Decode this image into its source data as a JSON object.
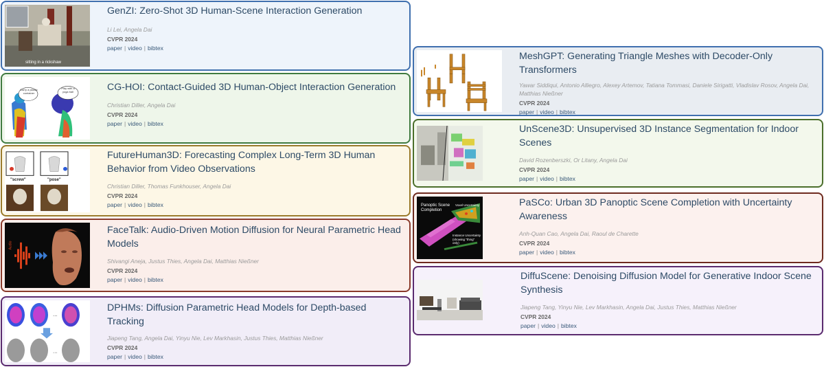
{
  "papers": [
    {
      "title": "GenZI: Zero-Shot 3D Human-Scene Interaction Generation",
      "authors": "Li Lei, Angela Dai",
      "venue": "CVPR 2024",
      "thumb_caption": "sitting in a rickshaw",
      "border": "#3f6fae",
      "bg": "#eef4fb"
    },
    {
      "title": "CG-HOI: Contact-Guided 3D Human-Object Interaction Generation",
      "authors": "Christian Diller, Angela Dai",
      "venue": "CVPR 2024",
      "thumb_labels": [
        "Carry a plastic container",
        "Play with a yoga ball"
      ],
      "border": "#3f7a3f",
      "bg": "#eef6ea"
    },
    {
      "title": "FutureHuman3D: Forecasting Complex Long-Term 3D Human Behavior from Video Observations",
      "authors": "Christian Diller, Thomas Funkhouser, Angela Dai",
      "venue": "CVPR 2024",
      "thumb_labels": [
        "\"screw\"",
        "\"pose\""
      ],
      "border": "#9a7a2a",
      "bg": "#fdf7e6"
    },
    {
      "title": "FaceTalk: Audio-Driven Motion Diffusion for Neural Parametric Head Models",
      "authors": "Shivangi Aneja, Justus Thies, Angela Dai, Matthias Nießner",
      "venue": "CVPR 2024",
      "thumb_label": "Audio",
      "border": "#8a3a2a",
      "bg": "#fbeeea"
    },
    {
      "title": "DPHMs: Diffusion Parametric Head Models for Depth-based Tracking",
      "authors": "Jiapeng Tang, Angela Dai, Yinyu Nie, Lev Markhasin, Justus Thies, Matthias Nießner",
      "venue": "CVPR 2024",
      "border": "#5a2a6e",
      "bg": "#f1edf8"
    },
    {
      "title": "MeshGPT: Generating Triangle Meshes with Decoder-Only Transformers",
      "authors": "Yawar Siddiqui, Antonio Alliegro, Alexey Artemov, Tatiana Tommasi, Daniele Sirigatti, Vladislav Rosov, Angela Dai, Matthias Nießner",
      "venue": "CVPR 2024",
      "border": "#3f6fae",
      "bg": "#e9edf2"
    },
    {
      "title": "UnScene3D: Unsupervised 3D Instance Segmentation for Indoor Scenes",
      "authors": "David Rozenberszki, Or Litany, Angela Dai",
      "venue": "CVPR 2024",
      "border": "#4a6e2a",
      "bg": "#f3f8ec"
    },
    {
      "title": "PaSCo: Urban 3D Panoptic Scene Completion with Uncertainty Awareness",
      "authors": "Anh-Quan Cao, Angela Dai, Raoul de Charette",
      "venue": "CVPR 2024",
      "thumb_labels": [
        "Panoptic Scene Completion",
        "Voxel Uncertainty",
        "Instance Uncertainty (showing \"thing\" only)"
      ],
      "border": "#6e2a1e",
      "bg": "#fcf1ee"
    },
    {
      "title": "DiffuScene: Denoising Diffusion Model for Generative Indoor Scene Synthesis",
      "authors": "Jiapeng Tang, Yinyu Nie, Lev Markhasin, Angela Dai, Justus Thies, Matthias Nießner",
      "venue": "CVPR 2024",
      "border": "#5a2a6e",
      "bg": "#f6f1fb"
    }
  ],
  "links": {
    "paper": "paper",
    "video": "video",
    "bibtex": "bibtex",
    "sep": "|"
  }
}
